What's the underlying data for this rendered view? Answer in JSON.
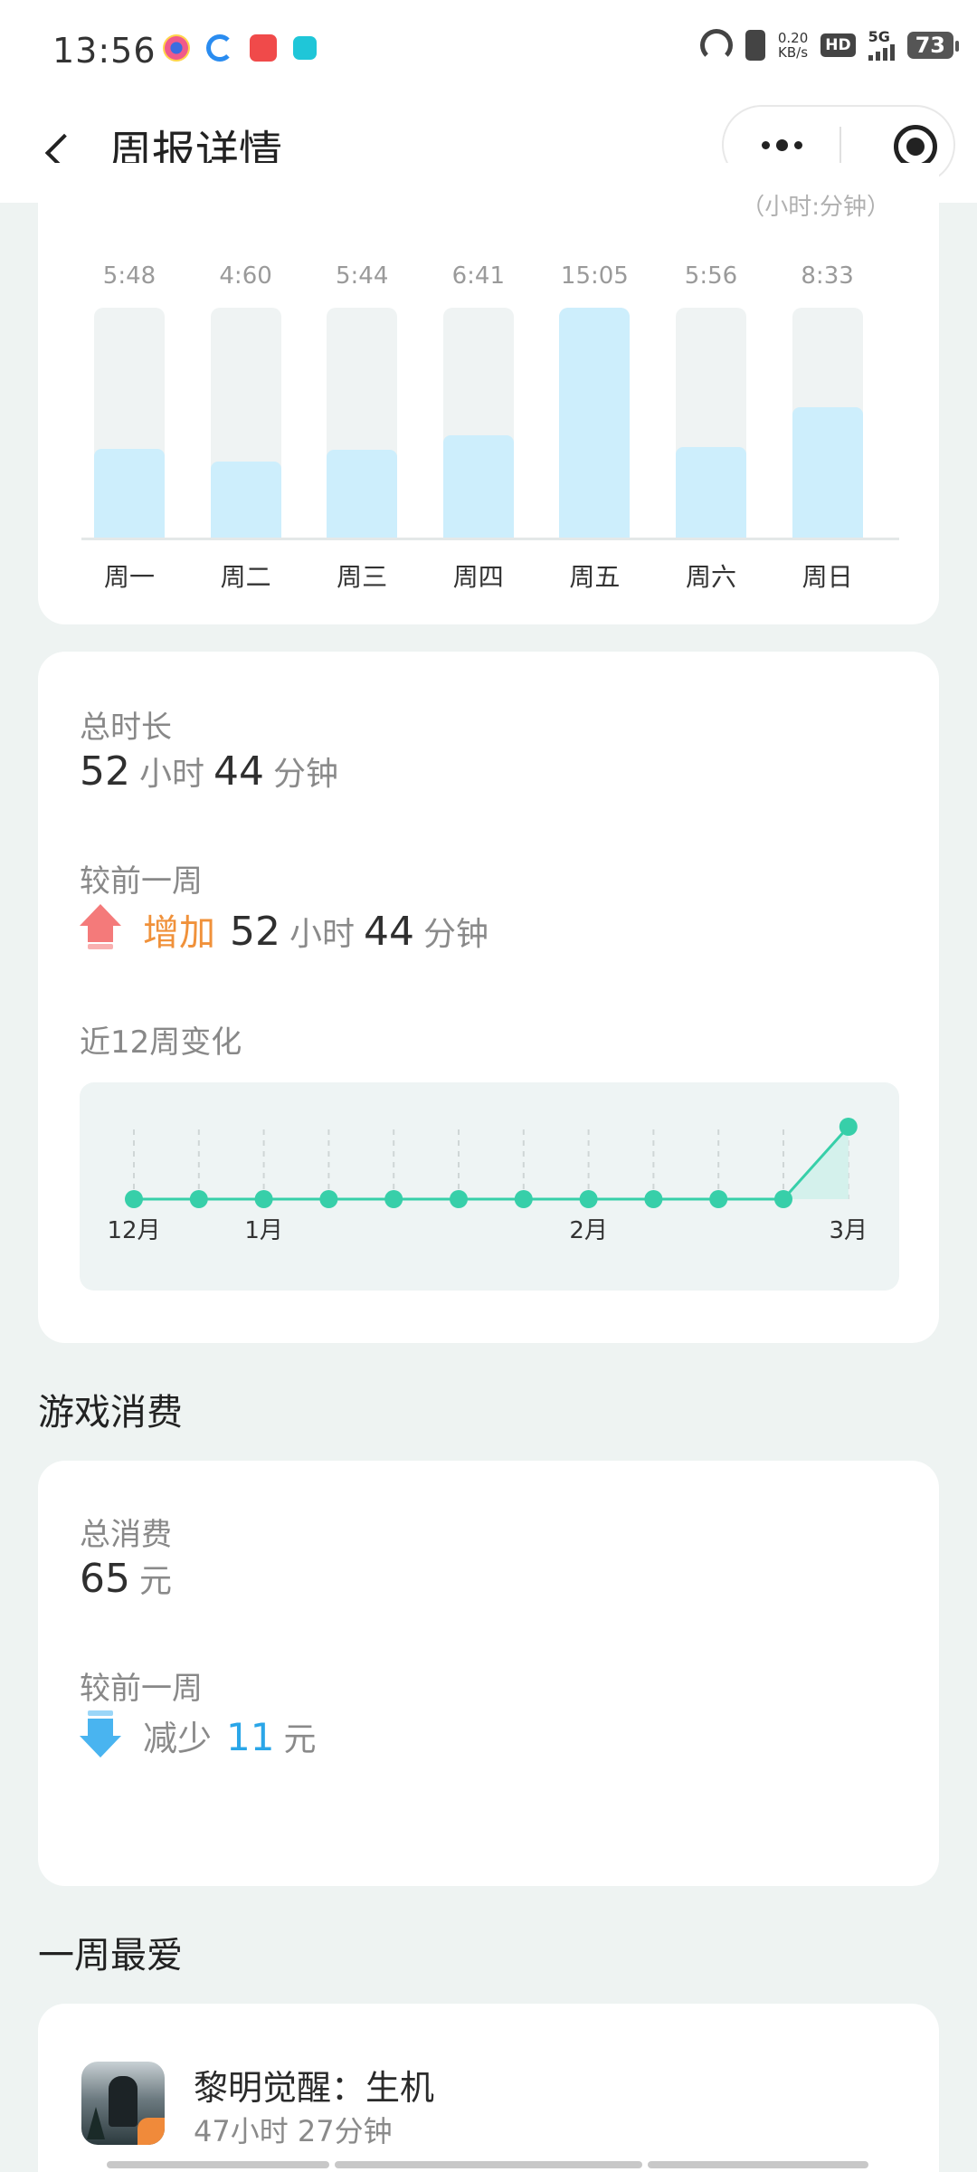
{
  "status_bar": {
    "time": "13:56",
    "net_speed_value": "0.20",
    "net_speed_unit": "KB/s",
    "hd": "HD",
    "network": "5G",
    "battery": "73"
  },
  "header": {
    "title": "周报详情"
  },
  "weekly_chart": {
    "unit_note": "（小时:分钟）",
    "days": [
      "周一",
      "周二",
      "周三",
      "周四",
      "周五",
      "周六",
      "周日"
    ],
    "value_labels": [
      "5:48",
      "4:60",
      "5:44",
      "6:41",
      "15:05",
      "5:56",
      "8:33"
    ]
  },
  "playtime": {
    "total_label": "总时长",
    "total_hours": "52",
    "total_hours_unit": "小时",
    "total_minutes": "44",
    "total_minutes_unit": "分钟",
    "compare_label": "较前一周",
    "change_word": "增加",
    "change_hours": "52",
    "change_hours_unit": "小时",
    "change_minutes": "44",
    "change_minutes_unit": "分钟",
    "trend_label": "近12周变化",
    "trend_month_labels": [
      "12月",
      "1月",
      "2月",
      "3月"
    ]
  },
  "spending": {
    "section_title": "游戏消费",
    "total_label": "总消费",
    "total_value": "65",
    "total_unit": "元",
    "compare_label": "较前一周",
    "change_word": "减少",
    "change_value": "11",
    "change_unit": "元"
  },
  "favorite": {
    "section_title": "一周最爱",
    "game_name": "黎明觉醒：生机",
    "game_time": "47小时 27分钟"
  },
  "chart_data": [
    {
      "type": "bar",
      "categories": [
        "周一",
        "周二",
        "周三",
        "周四",
        "周五",
        "周六",
        "周日"
      ],
      "values": [
        5.8,
        5.0,
        5.73,
        6.68,
        15.08,
        5.93,
        8.55
      ],
      "value_labels": [
        "5:48",
        "4:60",
        "5:44",
        "6:41",
        "15:05",
        "5:56",
        "8:33"
      ],
      "ylabel": "（小时:分钟）",
      "ylim": [
        0,
        15.08
      ]
    },
    {
      "type": "line",
      "x": [
        "",
        "",
        "",
        "",
        "",
        "",
        "",
        "",
        "",
        "",
        "",
        ""
      ],
      "x_tick_labels": [
        "12月",
        "1月",
        "2月",
        "3月"
      ],
      "values": [
        0,
        0,
        0,
        0,
        0,
        0,
        0,
        0,
        0,
        0,
        0,
        52.73
      ],
      "ylim": [
        0,
        52.73
      ]
    }
  ]
}
